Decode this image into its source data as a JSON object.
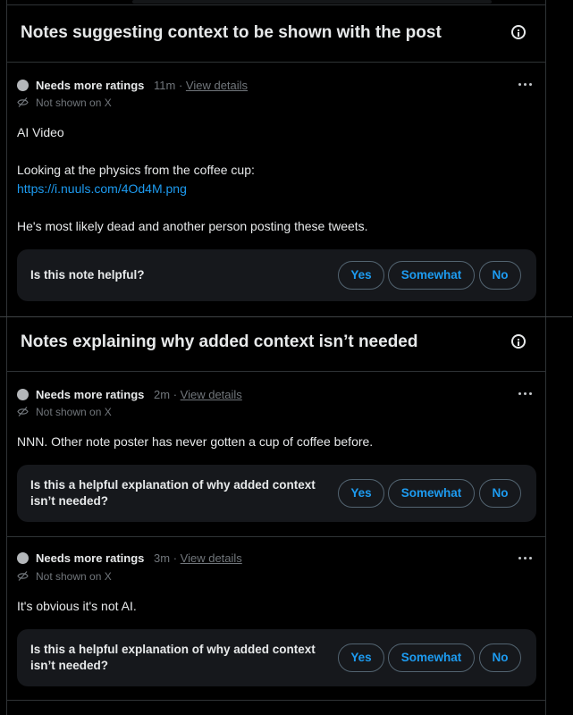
{
  "sections": {
    "shown_header": "Notes suggesting context to be shown with the post",
    "not_needed_header": "Notes explaining why added context isn’t needed"
  },
  "notes": [
    {
      "status": "Needs more ratings",
      "time": "11m",
      "separator": "·",
      "details_link": "View details",
      "visibility": "Not shown on X",
      "lines": [
        "AI Video",
        "Looking at the physics from the coffee cup:",
        "https://i.nuuls.com/4Od4M.png",
        "He's most likely dead and another person posting these tweets."
      ],
      "rating_question": "Is this note helpful?",
      "buttons": [
        "Yes",
        "Somewhat",
        "No"
      ]
    },
    {
      "status": "Needs more ratings",
      "time": "2m",
      "separator": "·",
      "details_link": "View details",
      "visibility": "Not shown on X",
      "lines": [
        "NNN. Other note poster has never gotten a cup of coffee before."
      ],
      "rating_question": [
        "Is this a helpful explanation of why added context",
        "isn’t needed?"
      ],
      "buttons": [
        "Yes",
        "Somewhat",
        "No"
      ]
    },
    {
      "status": "Needs more ratings",
      "time": "3m",
      "separator": "·",
      "details_link": "View details",
      "visibility": "Not shown on X",
      "lines": [
        "It's obvious it's not AI."
      ],
      "rating_question": [
        "Is this a helpful explanation of why added context",
        "isn’t needed?"
      ],
      "buttons": [
        "Yes",
        "Somewhat",
        "No"
      ]
    }
  ],
  "icons": {
    "status_dot": "status-dot-icon",
    "hidden": "eye-slash-icon",
    "more": "more-horizontal-icon",
    "info": "info-icon"
  },
  "colors": {
    "background": "#000000",
    "link": "#1d9bf0",
    "muted_text": "#71767b",
    "card": "#16181c",
    "border": "#2f3336"
  }
}
